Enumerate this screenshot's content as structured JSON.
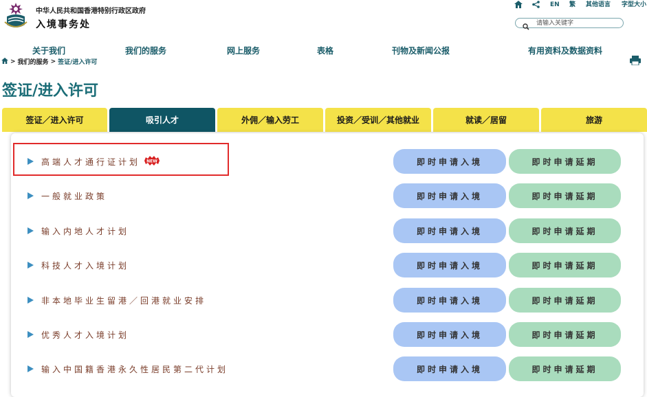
{
  "header": {
    "gov_name": "中华人民共和国香港特别行政区政府",
    "dept_name": "入境事务处"
  },
  "utility": {
    "lang_en": "EN",
    "lang_trad": "繁",
    "other_lang": "其他语言",
    "font_size": "字型大小"
  },
  "search": {
    "placeholder": "请输入关键字"
  },
  "nav": [
    "关于我们",
    "我们的服务",
    "网上服务",
    "表格",
    "刊物及新闻公报",
    "有用资料及数据资料"
  ],
  "breadcrumb": {
    "sep": ">",
    "items": [
      "我们的服务",
      "签证/进入许可"
    ]
  },
  "page_title": "签证/进入许可",
  "tabs": [
    {
      "label": "签证／进入许可",
      "active": false
    },
    {
      "label": "吸引人才",
      "active": true
    },
    {
      "label": "外佣／输入劳工",
      "active": false
    },
    {
      "label": "投资／受训／其他就业",
      "active": false
    },
    {
      "label": "就读／居留",
      "active": false
    },
    {
      "label": "旅游",
      "active": false
    }
  ],
  "badge": {
    "new": "NEW"
  },
  "items": [
    {
      "label": "高端人才通行证计划",
      "new": true
    },
    {
      "label": "一般就业政策"
    },
    {
      "label": "输入内地人才计划"
    },
    {
      "label": "科技人才入境计划"
    },
    {
      "label": "非本地毕业生留港／回港就业安排"
    },
    {
      "label": "优秀人才入境计划"
    },
    {
      "label": "输入中国籍香港永久性居民第二代计划"
    }
  ],
  "buttons": {
    "apply_entry": "即时申请入境",
    "apply_extension": "即时申请延期"
  },
  "colors": {
    "brand_teal": "#1b5d6a",
    "tab_yellow": "#f4e249",
    "tab_active": "#0f5564",
    "btn_entry": "#a9c6f4",
    "btn_extension": "#a9dcbd",
    "highlight_red": "#e12a2a"
  }
}
